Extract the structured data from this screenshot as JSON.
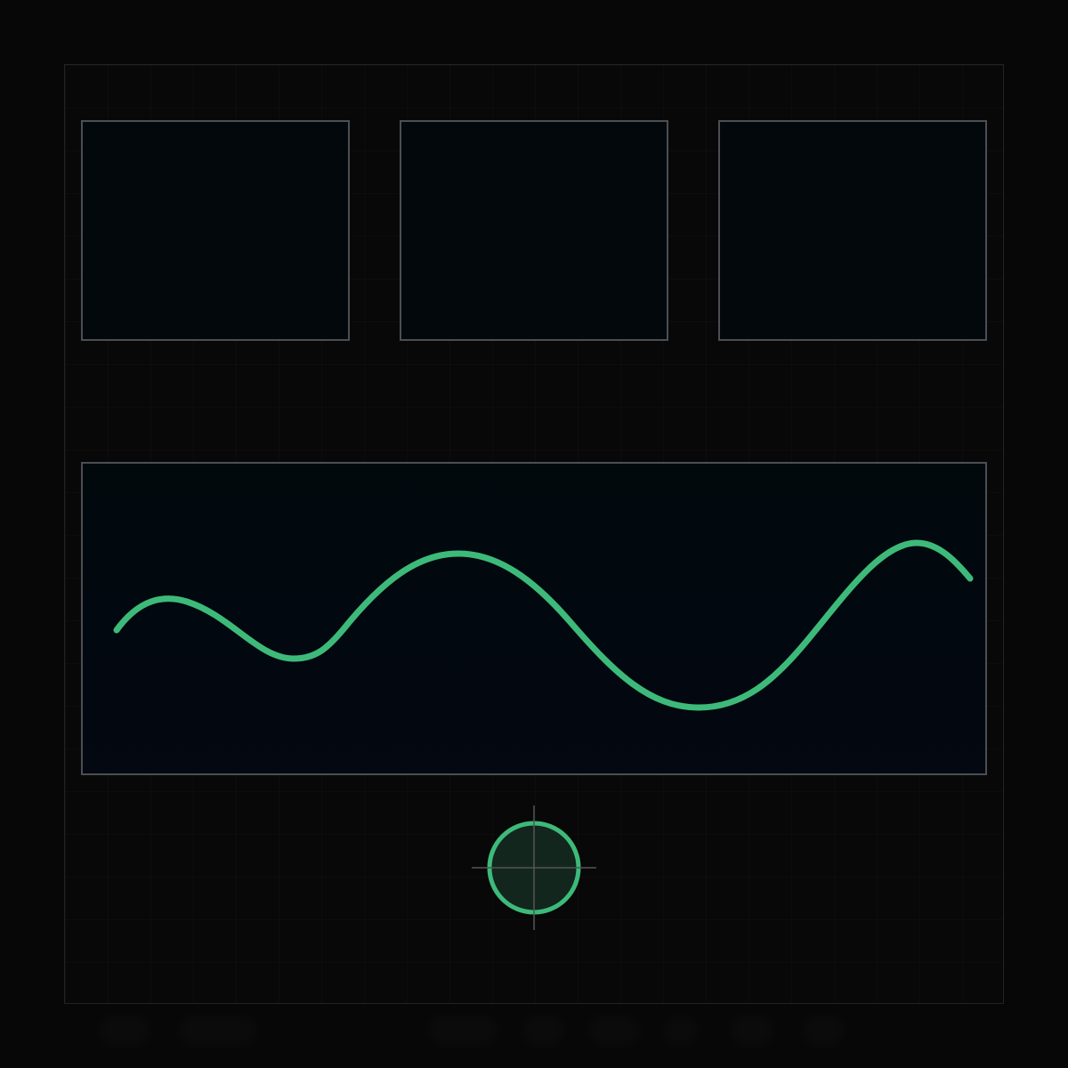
{
  "colors": {
    "background": "#070707",
    "panel_border": "#4b4f53",
    "panel_fill": "#02080c",
    "waveform": "#3dba7a",
    "target_fill": "#12261d",
    "crosshair": "#555555"
  },
  "icons": {
    "target": "crosshair-circle-icon"
  }
}
